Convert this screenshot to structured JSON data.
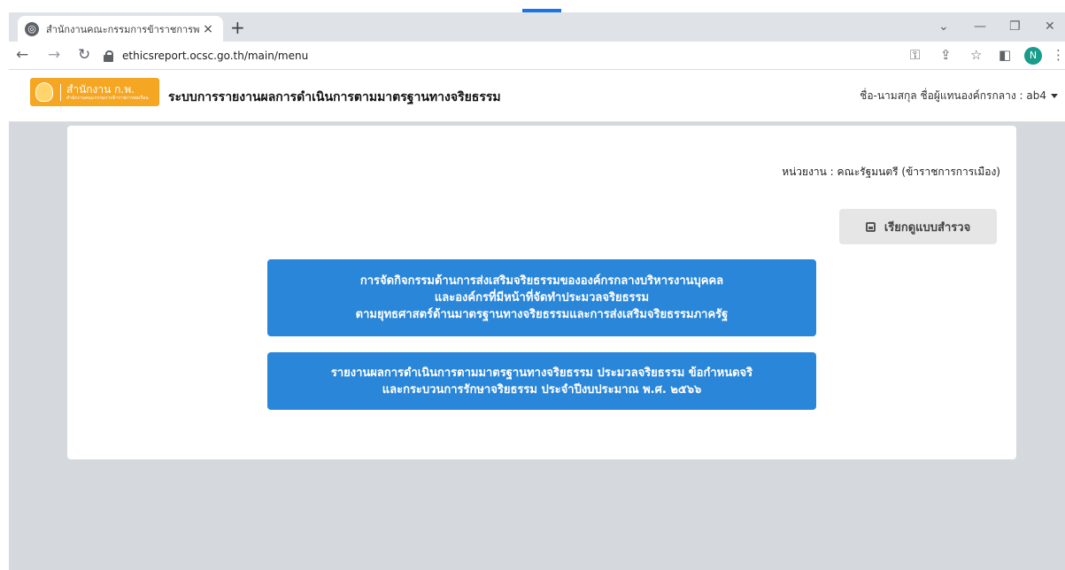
{
  "browser": {
    "tab_title": "สำนักงานคณะกรรมการข้าราชการพลเรือน",
    "tab_close": "×",
    "new_tab": "+",
    "url": "ethicsreport.ocsc.go.th/main/menu",
    "profile_initial": "N",
    "accent_color": "#1a73e8"
  },
  "header": {
    "logo_text": "สำนักงาน ก.พ.",
    "logo_subtext": "สำนักงานคณะกรรมการข้าราชการพลเรือน",
    "title": "ระบบการรายงานผลการดำเนินการตามมาตรฐานทางจริยธรรม",
    "user_label": "ชื่อ-นามสกุล ชื่อผู้แทนองค์กรกลาง : ab4"
  },
  "main": {
    "agency": "หน่วยงาน : คณะรัฐมนตรี (ข้าราชการการเมือง)",
    "survey_button": "เรียกดูแบบสำรวจ",
    "button1": {
      "line1": "การจัดกิจกรรมด้านการส่งเสริมจริยธรรมขององค์กรกลางบริหารงานบุคคล",
      "line2": "และองค์กรที่มีหน้าที่จัดทำประมวลจริยธรรม",
      "line3": "ตามยุทธศาสตร์ด้านมาตรฐานทางจริยธรรมและการส่งเสริมจริยธรรมภาครัฐ"
    },
    "button2": {
      "line1": "รายงานผลการดำเนินการตามมาตรฐานทางจริยธรรม ประมวลจริยธรรม ข้อกำหนดจริ",
      "line2": "และกระบวนการรักษาจริยธรรม ประจำปีงบประมาณ พ.ศ. ๒๕๖๖"
    },
    "button_color": "#2a86d8",
    "background_color": "#d5d8dc"
  }
}
